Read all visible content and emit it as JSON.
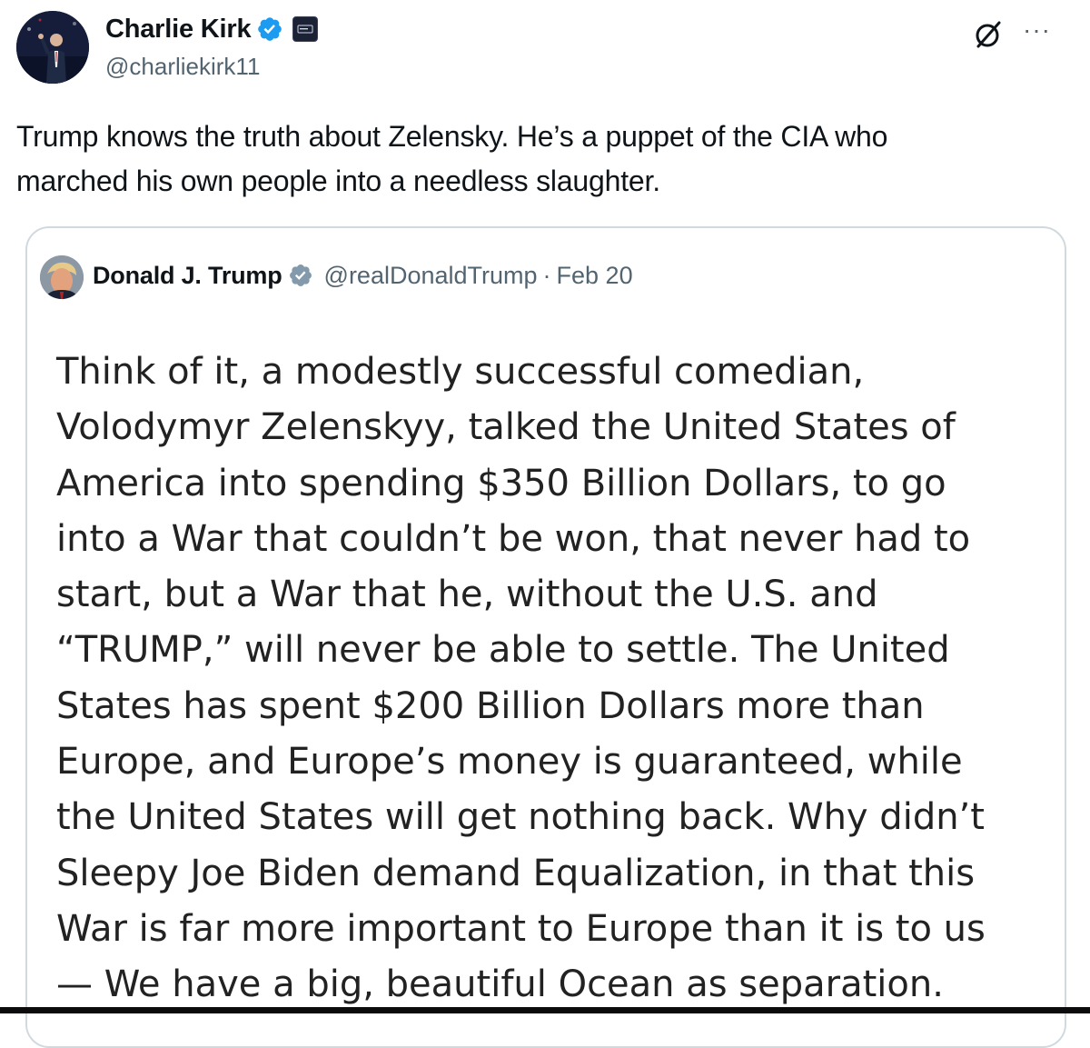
{
  "post": {
    "author": {
      "display_name": "Charlie Kirk",
      "handle": "@charliekirk11",
      "verified": true,
      "verified_color": "#1d9bf0"
    },
    "text_lines": [
      "Trump knows the truth about Zelensky. He’s a puppet of the CIA who",
      "marched his own people into a needless slaughter."
    ],
    "icons": [
      "verified-badge-icon",
      "affiliate-badge-icon",
      "grok-icon",
      "more-icon"
    ],
    "more_label": "···"
  },
  "quote": {
    "author": {
      "display_name": "Donald J. Trump",
      "handle": "@realDonaldTrump",
      "separator": "·",
      "date": "Feb 20",
      "verified": true,
      "verified_color": "#829aab"
    },
    "body_lines": [
      "Think of it, a modestly successful comedian,",
      "Volodymyr Zelenskyy, talked the United States of",
      "America into spending $350 Billion Dollars, to go",
      "into a War that couldn’t be won, that never had to",
      "start, but a War that he, without the U.S. and",
      "“TRUMP,” will never be able to settle. The United",
      "States has spent $200 Billion Dollars more than",
      "Europe, and Europe’s money is guaranteed, while",
      "the United States will get nothing back. Why didn’t",
      "Sleepy Joe Biden demand Equalization, in that this",
      "War is far more important to Europe than it is to us",
      "— We have a big, beautiful Ocean as separation."
    ]
  },
  "colors": {
    "text": "#0f1419",
    "secondary_text": "#536471",
    "card_border": "#cfd9de",
    "verified_blue": "#1d9bf0",
    "verified_gray": "#829aab"
  }
}
